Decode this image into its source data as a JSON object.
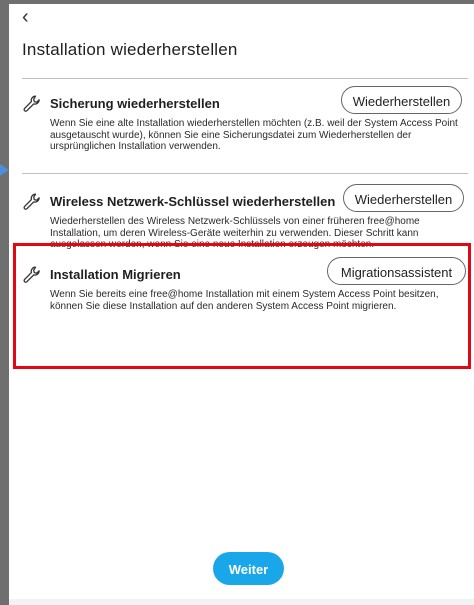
{
  "header": {
    "back_icon": "chevron-left-icon",
    "back_glyph": "‹",
    "title": "Installation wiederherstellen"
  },
  "sections": [
    {
      "icon": "wrench-icon",
      "title": "Sicherung wiederherstellen",
      "button_label": "Wiederherstellen",
      "description": "Wenn Sie eine alte Installation wiederherstellen möchten (z.B. weil der System Access Point ausgetauscht wurde), können Sie eine Sicherungsdatei zum Wiederherstellen der ursprünglichen Installation verwenden."
    },
    {
      "icon": "wrench-icon",
      "title": "Wireless Netzwerk-Schlüssel wiederherstellen",
      "button_label": "Wiederherstellen",
      "description": "Wiederherstellen des Wireless Netzwerk-Schlüssels von einer früheren free@home Installation, um deren Wireless-Geräte weiterhin zu verwenden. Dieser Schritt kann ausgelassen werden, wenn Sie eine neue Installation erzeugen möchten."
    },
    {
      "icon": "wrench-icon",
      "title": "Installation Migrieren",
      "button_label": "Migrationsassistent",
      "description": "Wenn Sie bereits eine free@home Installation mit einem System Access Point besitzen, können Sie diese Installation auf den anderen System Access Point migrieren.",
      "highlighted": true
    }
  ],
  "footer": {
    "next_label": "Weiter"
  },
  "colors": {
    "accent": "#1aa7ea",
    "highlight": "#e30613",
    "frame": "#6f6f6f"
  }
}
